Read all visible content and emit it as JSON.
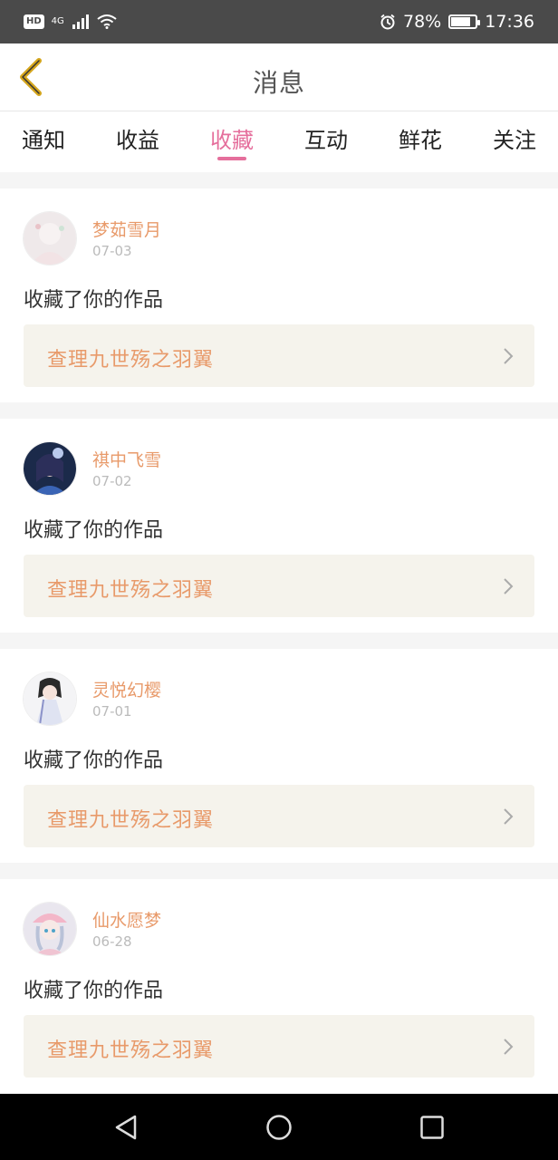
{
  "status_bar": {
    "hd": "HD",
    "network": "4G",
    "battery_percent": "78%",
    "battery_level": 0.78,
    "time": "17:36"
  },
  "header": {
    "title": "消息"
  },
  "tabs": [
    {
      "label": "通知"
    },
    {
      "label": "收益"
    },
    {
      "label": "收藏",
      "active": true
    },
    {
      "label": "互动"
    },
    {
      "label": "鲜花"
    },
    {
      "label": "关注"
    }
  ],
  "messages": [
    {
      "user": "梦茹雪月",
      "date": "07-03",
      "action": "收藏了你的作品",
      "work": "查理九世殇之羽翼"
    },
    {
      "user": "祺中飞雪",
      "date": "07-02",
      "action": "收藏了你的作品",
      "work": "查理九世殇之羽翼"
    },
    {
      "user": "灵悦幻樱",
      "date": "07-01",
      "action": "收藏了你的作品",
      "work": "查理九世殇之羽翼"
    },
    {
      "user": "仙水愿梦",
      "date": "06-28",
      "action": "收藏了你的作品",
      "work": "查理九世殇之羽翼"
    }
  ],
  "colors": {
    "accent": "#e56f9c",
    "username": "#e89a6a",
    "work_bg": "#f5f3ec",
    "back_icon": "#d4a51c"
  },
  "icons": {
    "back": "chevron-left-icon",
    "work_link": "chevron-right-icon",
    "nav_back": "triangle-back-icon",
    "nav_home": "circle-home-icon",
    "nav_recents": "square-recents-icon"
  }
}
